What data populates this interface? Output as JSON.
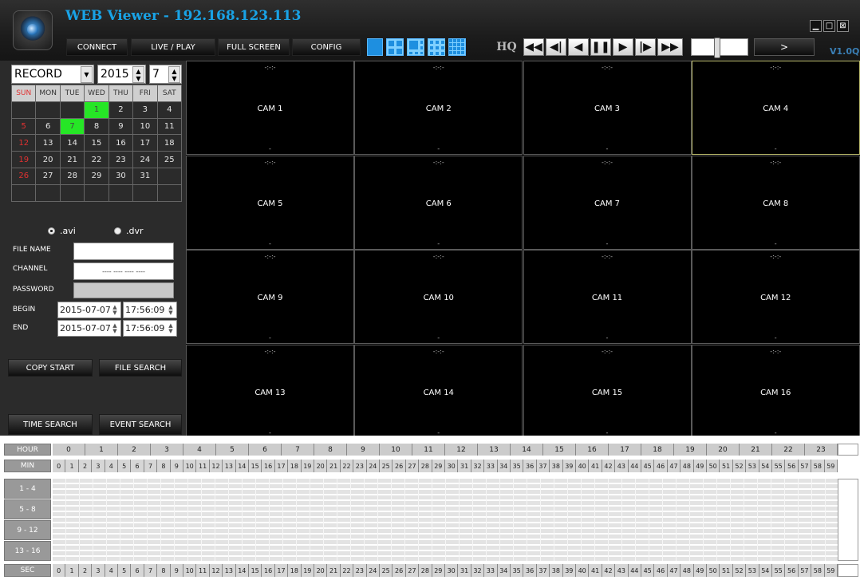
{
  "header": {
    "title": "WEB Viewer - 192.168.123.113",
    "buttons": [
      "CONNECT",
      "LIVE / PLAY",
      "FULL SCREEN",
      "CONFIG"
    ],
    "hq_label": "HQ",
    "go_label": ">",
    "version": "V1.0Q",
    "playback_icons": [
      "fast-rewind-icon",
      "step-back-icon",
      "reverse-play-icon",
      "pause-icon",
      "play-icon",
      "step-forward-icon",
      "fast-forward-icon"
    ]
  },
  "search": {
    "mode": "RECORD",
    "year": "2015",
    "month": "7",
    "weekdays": [
      "SUN",
      "MON",
      "TUE",
      "WED",
      "THU",
      "FRI",
      "SAT"
    ],
    "weeks": [
      [
        "",
        "",
        "",
        "1",
        "2",
        "3",
        "4"
      ],
      [
        "5",
        "6",
        "7",
        "8",
        "9",
        "10",
        "11"
      ],
      [
        "12",
        "13",
        "14",
        "15",
        "16",
        "17",
        "18"
      ],
      [
        "19",
        "20",
        "21",
        "22",
        "23",
        "24",
        "25"
      ],
      [
        "26",
        "27",
        "28",
        "29",
        "30",
        "31",
        ""
      ],
      [
        "",
        "",
        "",
        "",
        "",
        "",
        ""
      ]
    ],
    "format_avi": ".avi",
    "format_dvr": ".dvr",
    "file_name_label": "FILE NAME",
    "channel_label": "CHANNEL",
    "channel_value": "---- ---- ---- ----",
    "password_label": "PASSWORD",
    "begin_label": "BEGIN",
    "begin_date": "2015-07-07",
    "begin_time": "17:56:09",
    "end_label": "END",
    "end_date": "2015-07-07",
    "end_time": "17:56:09",
    "copy_start": "COPY START",
    "file_search": "FILE SEARCH",
    "time_search": "TIME SEARCH",
    "event_search": "EVENT SEARCH"
  },
  "cameras": [
    {
      "name": "CAM 1",
      "ts": "-:-:-",
      "ft": "-"
    },
    {
      "name": "CAM 2",
      "ts": "-:-:-",
      "ft": "-"
    },
    {
      "name": "CAM 3",
      "ts": "-:-:-",
      "ft": "-"
    },
    {
      "name": "CAM 4",
      "ts": "-:-:-",
      "ft": "-"
    },
    {
      "name": "CAM 5",
      "ts": "-:-:-",
      "ft": "-"
    },
    {
      "name": "CAM 6",
      "ts": "-:-:-",
      "ft": "-"
    },
    {
      "name": "CAM 7",
      "ts": "-:-:-",
      "ft": "-"
    },
    {
      "name": "CAM 8",
      "ts": "-:-:-",
      "ft": "-"
    },
    {
      "name": "CAM 9",
      "ts": "-:-:-",
      "ft": "-"
    },
    {
      "name": "CAM 10",
      "ts": "-:-:-",
      "ft": "-"
    },
    {
      "name": "CAM 11",
      "ts": "-:-:-",
      "ft": "-"
    },
    {
      "name": "CAM 12",
      "ts": "-:-:-",
      "ft": "-"
    },
    {
      "name": "CAM 13",
      "ts": "-:-:-",
      "ft": "-"
    },
    {
      "name": "CAM 14",
      "ts": "-:-:-",
      "ft": "-"
    },
    {
      "name": "CAM 15",
      "ts": "-:-:-",
      "ft": "-"
    },
    {
      "name": "CAM 16",
      "ts": "-:-:-",
      "ft": "-"
    }
  ],
  "timeline": {
    "hour_label": "HOUR",
    "min_label": "MIN",
    "sec_label": "SEC",
    "groups": [
      "1 - 4",
      "5 - 8",
      "9 - 12",
      "13 - 16"
    ]
  },
  "colors": {
    "title": "#19a3e6",
    "accent": "#1e8fe0",
    "highlight": "#26e626",
    "sunday": "#e23131"
  }
}
